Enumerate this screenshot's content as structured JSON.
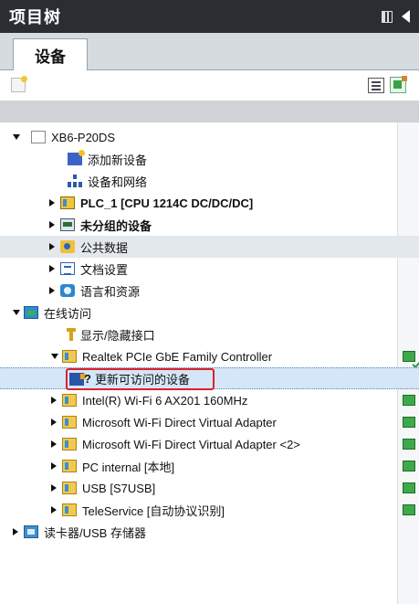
{
  "header": {
    "title": "项目树"
  },
  "tabs": [
    {
      "label": "设备"
    }
  ],
  "toolbar": {
    "left_icon": "new-device-icon",
    "right_icons": [
      "overview-icon",
      "export-icon"
    ]
  },
  "tree": {
    "root": {
      "label": "XB6-P20DS"
    },
    "items": [
      {
        "label": "添加新设备",
        "icon": "add-device-icon"
      },
      {
        "label": "设备和网络",
        "icon": "network-icon"
      },
      {
        "label": "PLC_1 [CPU 1214C DC/DC/DC]",
        "icon": "plc-icon"
      },
      {
        "label": "未分组的设备",
        "icon": "ungrouped-devices-icon"
      },
      {
        "label": "公共数据",
        "icon": "common-data-icon"
      },
      {
        "label": "文档设置",
        "icon": "document-settings-icon"
      },
      {
        "label": "语言和资源",
        "icon": "languages-icon"
      }
    ],
    "online": {
      "label": "在线访问",
      "items": [
        {
          "label": "显示/隐藏接口"
        },
        {
          "label": "Realtek PCIe GbE Family Controller",
          "status": "connected"
        },
        {
          "label": "更新可访问的设备",
          "prefix": "?"
        },
        {
          "label": "Intel(R) Wi-Fi 6 AX201 160MHz",
          "status": "ok"
        },
        {
          "label": "Microsoft Wi-Fi Direct Virtual Adapter",
          "status": "ok"
        },
        {
          "label": "Microsoft Wi-Fi Direct Virtual Adapter <2>",
          "status": "ok"
        },
        {
          "label": "PC internal [本地]",
          "status": "ok"
        },
        {
          "label": "USB [S7USB]",
          "status": "ok"
        },
        {
          "label": "TeleService [自动协议识别]",
          "status": "ok"
        }
      ]
    },
    "card_reader": {
      "label": "读卡器/USB 存储器"
    }
  },
  "colors": {
    "title_bg": "#2a2e33",
    "highlight": "#e0202a",
    "status_green": "#3ea94b"
  }
}
